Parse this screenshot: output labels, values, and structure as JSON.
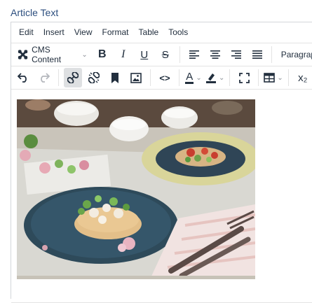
{
  "field_label": "Article Text",
  "menubar": {
    "items": [
      "Edit",
      "Insert",
      "View",
      "Format",
      "Table",
      "Tools"
    ]
  },
  "toolbar1": {
    "cms_content_label": "CMS Content",
    "paragraph_label": "Paragraph"
  },
  "icons": {
    "bold": "B",
    "italic": "I",
    "underline": "U",
    "strikethrough": "S",
    "code": "<>",
    "font_color": "A",
    "subscript": "x₂"
  },
  "colors": {
    "label": "#2c4e7e",
    "active_button": "#dee0e2",
    "text": "#222f3e"
  }
}
